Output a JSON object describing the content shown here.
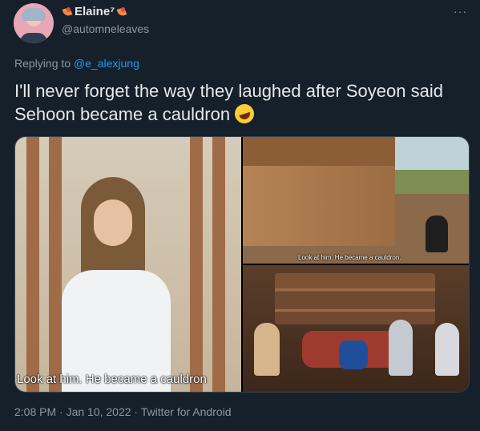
{
  "author": {
    "display_name": "Elaine⁷",
    "handle": "@automneleaves"
  },
  "reply": {
    "prefix": "Replying to ",
    "target": "@e_alexjung"
  },
  "tweet": {
    "text": "I'll never forget the way they laughed after Soyeon said Sehoon became a cauldron"
  },
  "media": {
    "subtitle_left": "Look at him. He became a cauldron",
    "subtitle_top_right": "Look at him. He became a cauldron."
  },
  "meta": {
    "time": "2:08 PM · Jan 10, 2022 · Twitter for Android"
  },
  "more": "···"
}
